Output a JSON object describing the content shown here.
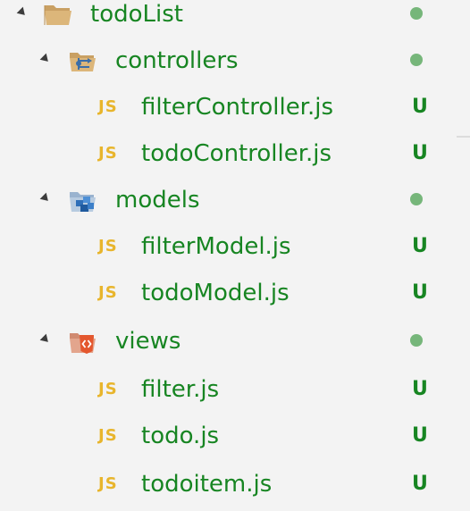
{
  "explorer": {
    "root": {
      "label": "todoList",
      "status": "modified-dot",
      "icon": "folder-open-icon"
    },
    "folders": [
      {
        "label": "controllers",
        "status": "modified-dot",
        "icon": "controllers-folder-icon",
        "files": [
          {
            "label": "filterController.js",
            "badge": "U",
            "icon_text": "JS"
          },
          {
            "label": "todoController.js",
            "badge": "U",
            "icon_text": "JS"
          }
        ]
      },
      {
        "label": "models",
        "status": "modified-dot",
        "icon": "models-folder-icon",
        "files": [
          {
            "label": "filterModel.js",
            "badge": "U",
            "icon_text": "JS"
          },
          {
            "label": "todoModel.js",
            "badge": "U",
            "icon_text": "JS"
          }
        ]
      },
      {
        "label": "views",
        "status": "modified-dot",
        "icon": "views-folder-icon",
        "files": [
          {
            "label": "filter.js",
            "badge": "U",
            "icon_text": "JS"
          },
          {
            "label": "todo.js",
            "badge": "U",
            "icon_text": "JS"
          },
          {
            "label": "todoitem.js",
            "badge": "U",
            "icon_text": "JS"
          }
        ]
      }
    ]
  },
  "colors": {
    "background": "#f3f3f3",
    "untracked_text": "#178522",
    "status_dot": "#76b67a",
    "js_icon": "#e8b52c",
    "folder": "#dcb67a"
  }
}
